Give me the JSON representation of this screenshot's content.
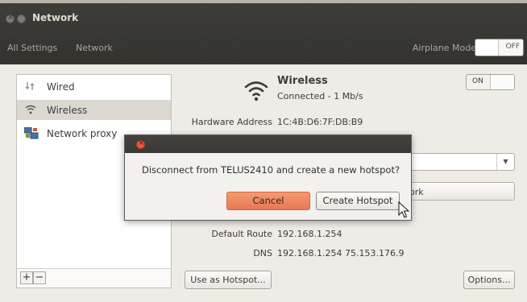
{
  "window": {
    "title": "Network",
    "breadcrumbs": [
      "All Settings",
      "Network"
    ],
    "airplane_mode_label": "Airplane Mode",
    "airplane_mode_state": "OFF"
  },
  "sidebar": {
    "items": [
      {
        "label": "Wired",
        "icon": "wired-network-icon",
        "selected": false
      },
      {
        "label": "Wireless",
        "icon": "wifi-icon",
        "selected": true
      },
      {
        "label": "Network proxy",
        "icon": "network-proxy-icon",
        "selected": false
      }
    ],
    "add_label": "+",
    "remove_label": "−"
  },
  "wireless": {
    "title": "Wireless",
    "status": "Connected - 1 Mb/s",
    "toggle_state": "ON",
    "hardware_address_label": "Hardware Address",
    "hardware_address": "1C:4B:D6:7F:DB:B9",
    "network_button_partial": "work",
    "default_route_label": "Default Route",
    "default_route": "192.168.1.254",
    "dns_label": "DNS",
    "dns": "192.168.1.254 75.153.176.9"
  },
  "buttons": {
    "hotspot": "Use as Hotspot...",
    "options": "Options..."
  },
  "dialog": {
    "message": "Disconnect from TELUS2410 and create a new hotspot?",
    "cancel_label": "Cancel",
    "create_label": "Create Hotspot"
  },
  "colors": {
    "accent_orange": "#e6784f",
    "titlebar": "#3c3b37",
    "close_button": "#e8593a"
  }
}
